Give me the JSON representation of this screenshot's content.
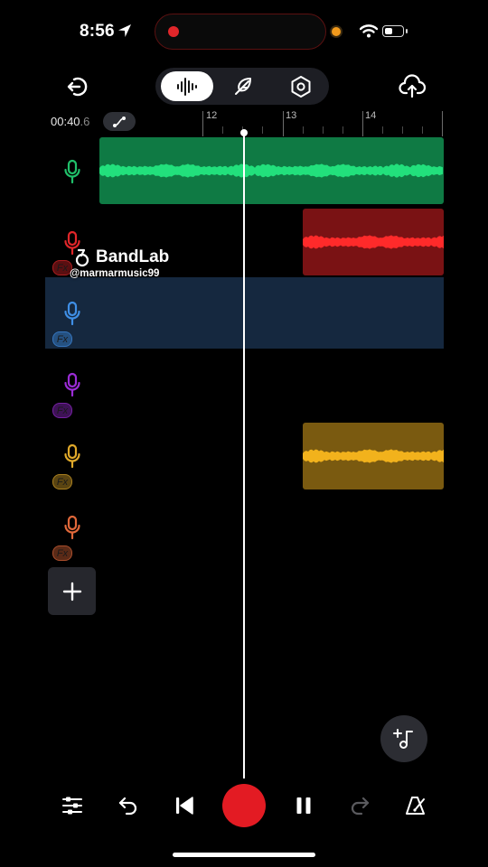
{
  "status_bar": {
    "time": "8:56",
    "icons": [
      "location-arrow-icon",
      "recording-indicator-icon",
      "camera-in-use-icon",
      "wifi-icon",
      "battery-icon"
    ]
  },
  "toolbar": {
    "icons": [
      "exit-icon",
      "waveform-icon",
      "feather-icon",
      "hexagon-settings-icon",
      "cloud-upload-icon"
    ],
    "active_mode": "waveform-icon"
  },
  "timeline": {
    "position_main": "00:40",
    "position_fraction": ".6",
    "ruler_labels": [
      "12",
      "13",
      "14"
    ]
  },
  "tracks": [
    {
      "color": "#20c06a",
      "region_color": "#0f7a44",
      "wave_color": "#22e07c",
      "fx_label": ""
    },
    {
      "color": "#e0262a",
      "region_color": "#7a1214",
      "wave_color": "#ff2a2a",
      "fx_label": "Fx"
    },
    {
      "color": "#3f8fe6",
      "region_color": "",
      "wave_color": "",
      "fx_label": "Fx"
    },
    {
      "color": "#9b2cd6",
      "region_color": "",
      "wave_color": "",
      "fx_label": "Fx"
    },
    {
      "color": "#e0a92a",
      "region_color": "#7a5a10",
      "wave_color": "#f2b21c",
      "fx_label": "Fx"
    },
    {
      "color": "#e0683a",
      "region_color": "",
      "wave_color": "",
      "fx_label": "Fx"
    }
  ],
  "watermark": {
    "brand": "BandLab",
    "handle": "@marmarmusic99"
  },
  "transport": {
    "icons": [
      "mixer-sliders-icon",
      "undo-icon",
      "skip-to-start-icon",
      "record-icon",
      "pause-icon",
      "redo-icon",
      "metronome-icon"
    ],
    "record_color": "#e31b23"
  }
}
